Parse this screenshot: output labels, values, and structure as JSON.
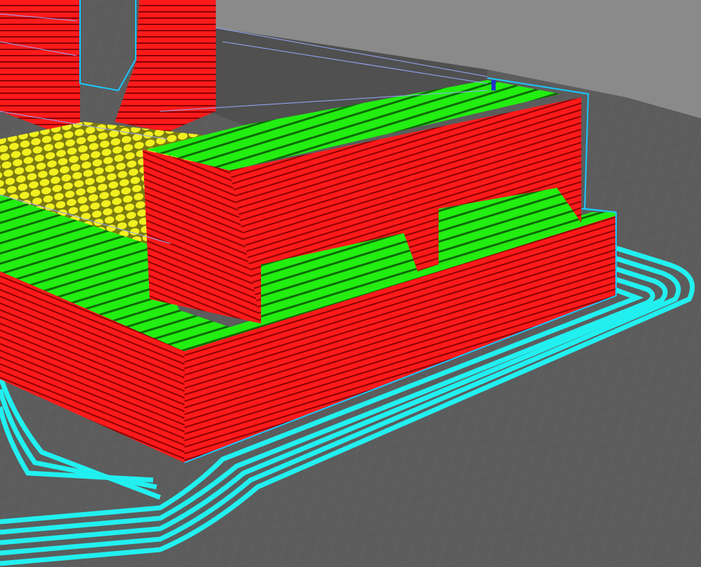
{
  "viewport": {
    "name": "layer-view-3d-preview",
    "colors": {
      "build_plate": "#5c5c5c",
      "build_plate_far": "#8a8a8a",
      "grid_line": "#666666",
      "wall_outer": "#ff1a1a",
      "wall_shadow": "#8a0000",
      "skin": "#22ee11",
      "infill": "#f2f020",
      "skirt": "#22f0f0",
      "travel": "#4488ff",
      "support_outline": "#18c8ff"
    }
  }
}
